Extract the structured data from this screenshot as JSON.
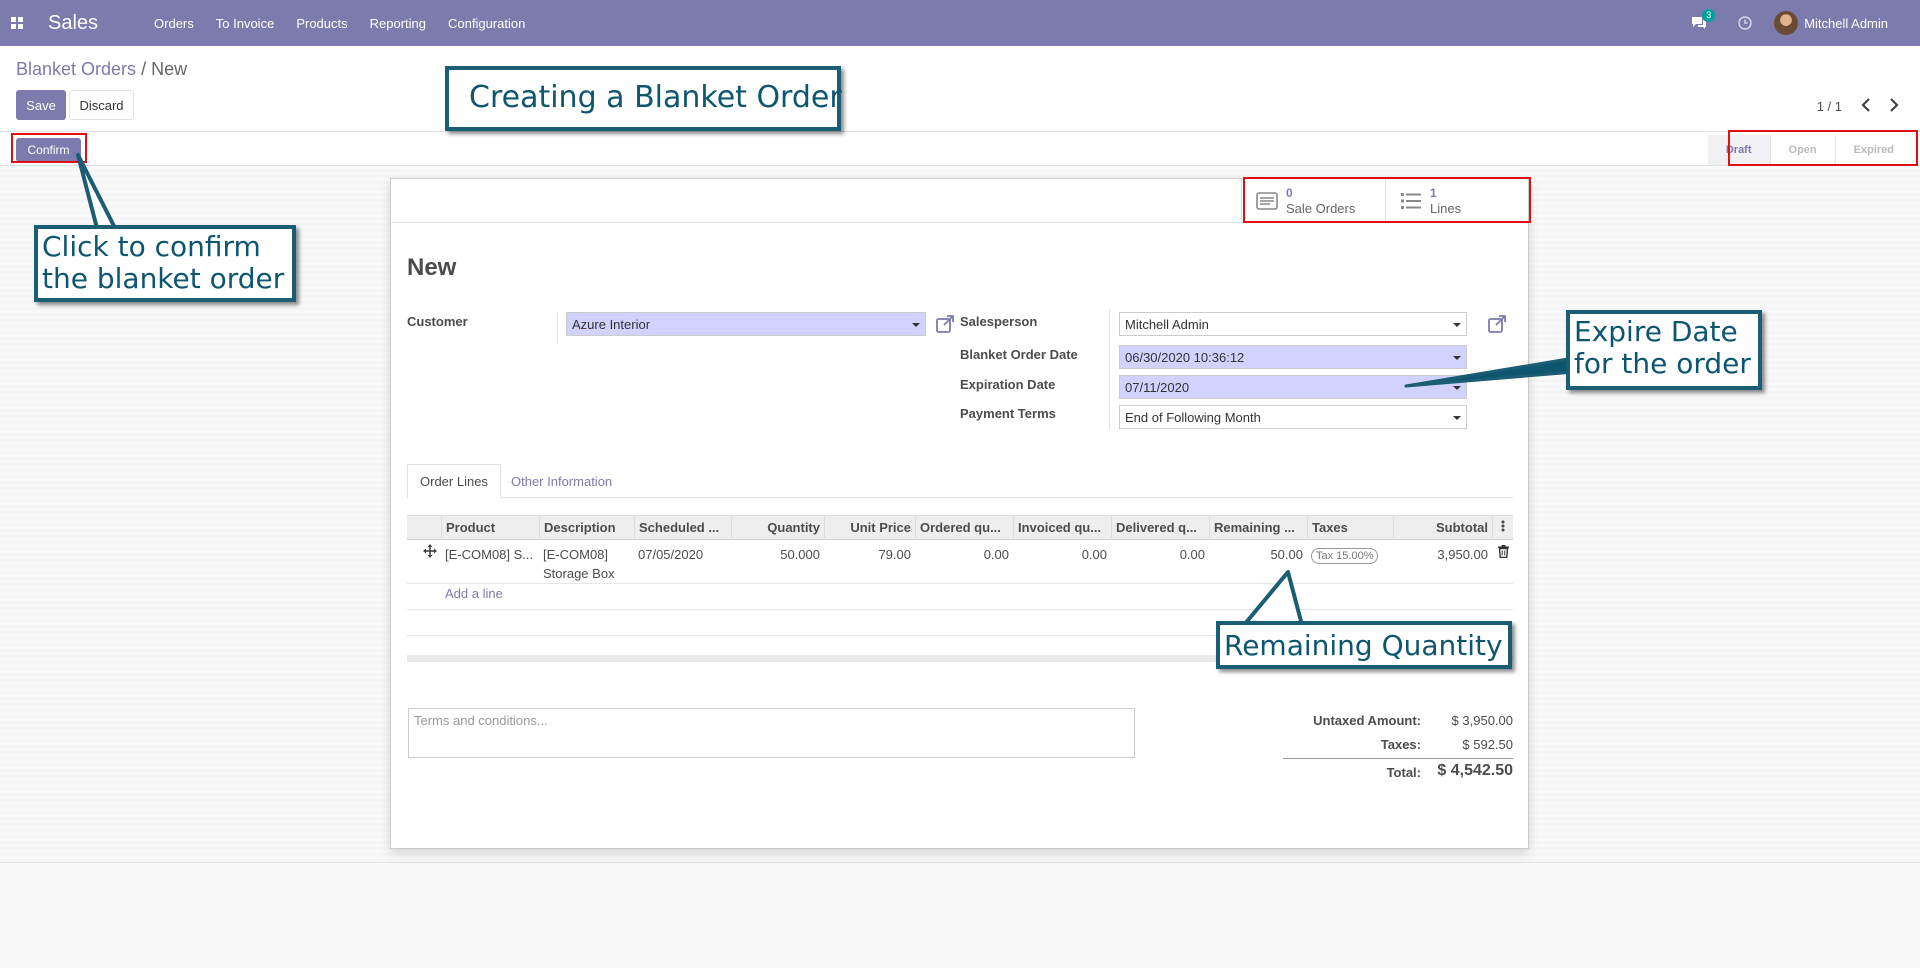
{
  "nav": {
    "brand": "Sales",
    "menu": [
      "Orders",
      "To Invoice",
      "Products",
      "Reporting",
      "Configuration"
    ],
    "chat_count": "3",
    "user": "Mitchell Admin"
  },
  "control": {
    "breadcrumb_parent": "Blanket Orders",
    "breadcrumb_sep": "/",
    "breadcrumb_current": "New",
    "save_label": "Save",
    "discard_label": "Discard",
    "pager": "1 / 1"
  },
  "status": {
    "confirm_label": "Confirm",
    "stages": [
      "Draft",
      "Open",
      "Expired"
    ],
    "active_stage": "Draft"
  },
  "smart_buttons": {
    "sale_orders_count": "0",
    "sale_orders_label": "Sale Orders",
    "lines_count": "1",
    "lines_label": "Lines"
  },
  "form": {
    "title": "New",
    "customer_label": "Customer",
    "customer_value": "Azure Interior",
    "salesperson_label": "Salesperson",
    "salesperson_value": "Mitchell Admin",
    "order_date_label": "Blanket Order Date",
    "order_date_value": "06/30/2020 10:36:12",
    "expiration_label": "Expiration Date",
    "expiration_value": "07/11/2020",
    "payment_terms_label": "Payment Terms",
    "payment_terms_value": "End of Following Month"
  },
  "tabs": [
    "Order Lines",
    "Other Information"
  ],
  "table": {
    "headers": [
      "Product",
      "Description",
      "Scheduled ...",
      "Quantity",
      "Unit Price",
      "Ordered qu...",
      "Invoiced qu...",
      "Delivered q...",
      "Remaining ...",
      "Taxes",
      "Subtotal"
    ],
    "row": {
      "product": "[E-COM08] S...",
      "description_1": "[E-COM08]",
      "description_2": "Storage Box",
      "scheduled": "07/05/2020",
      "quantity": "50.000",
      "unit_price": "79.00",
      "ordered": "0.00",
      "invoiced": "0.00",
      "delivered": "0.00",
      "remaining": "50.00",
      "tax": "Tax 15.00%",
      "subtotal": "3,950.00"
    },
    "add_line": "Add a line"
  },
  "terms_placeholder": "Terms and conditions...",
  "totals": {
    "untaxed_label": "Untaxed Amount:",
    "untaxed_value": "$ 3,950.00",
    "taxes_label": "Taxes:",
    "taxes_value": "$ 592.50",
    "total_label": "Total:",
    "total_value": "$ 4,542.50"
  },
  "annotations": {
    "title": "Creating a Blanket Order",
    "confirm_1": "Click to confirm",
    "confirm_2": "the blanket order",
    "expire_1": "Expire Date",
    "expire_2": "for the order",
    "remaining": "Remaining Quantity"
  },
  "colors": {
    "brand": "#7c7bad",
    "annotation_border": "#1b5d73",
    "highlight_red": "#e01010",
    "required_field": "#d2d2ff"
  }
}
